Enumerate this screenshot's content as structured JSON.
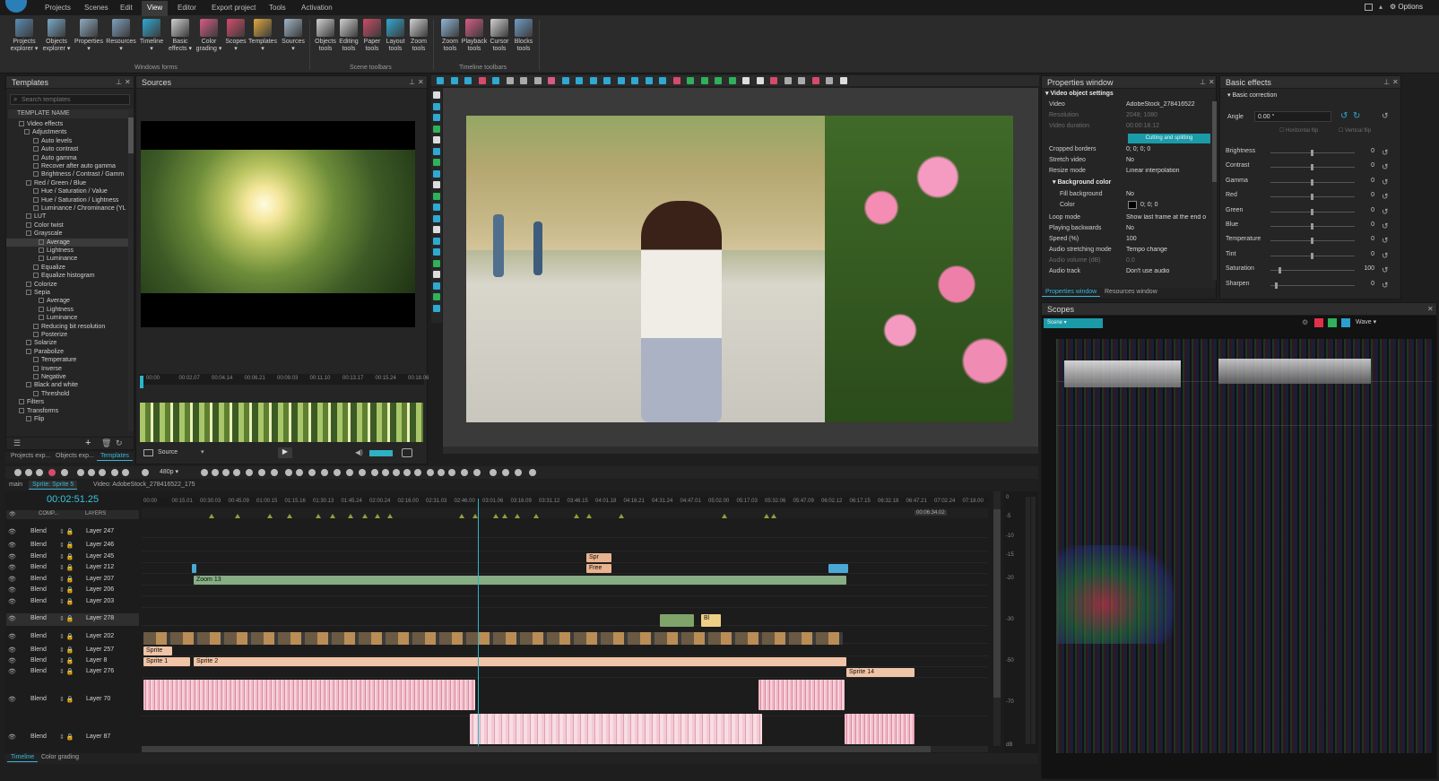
{
  "menu": {
    "items": [
      "Projects",
      "Scenes",
      "Edit",
      "View",
      "Editor",
      "Export project",
      "Tools",
      "Activation"
    ],
    "active": "View",
    "options": "Options"
  },
  "ribbon": {
    "buttons": [
      {
        "label": "Projects\nexplorer ▾",
        "icon": "projects-explorer-icon"
      },
      {
        "label": "Objects\nexplorer ▾",
        "icon": "objects-explorer-icon"
      },
      {
        "label": "Properties\n▾",
        "icon": "properties-icon"
      },
      {
        "label": "Resources\n▾",
        "icon": "resources-icon"
      },
      {
        "label": "Timeline\n▾",
        "icon": "timeline-icon"
      },
      {
        "label": "Basic\neffects ▾",
        "icon": "fx-icon"
      },
      {
        "label": "Color\ngrading ▾",
        "icon": "color-grading-icon"
      },
      {
        "label": "Scopes\n▾",
        "icon": "scopes-icon"
      },
      {
        "label": "Templates\n▾",
        "icon": "templates-icon"
      },
      {
        "label": "Sources\n▾",
        "icon": "sources-icon"
      },
      {
        "label": "Objects\ntools",
        "icon": "gear-icon"
      },
      {
        "label": "Editing\ntools",
        "icon": "pencil-icon"
      },
      {
        "label": "Paper\ntools",
        "icon": "paper-icon"
      },
      {
        "label": "Layout\ntools",
        "icon": "layout-icon"
      },
      {
        "label": "Zoom\ntools",
        "icon": "zoom-icon"
      },
      {
        "label": "Zoom\ntools",
        "icon": "zoom-timeline-icon"
      },
      {
        "label": "Playback\ntools",
        "icon": "playback-icon"
      },
      {
        "label": "Cursor\ntools",
        "icon": "cursor-icon"
      },
      {
        "label": "Blocks\ntools",
        "icon": "blocks-icon"
      }
    ],
    "groups": [
      "Windows forms",
      "Scene toolbars",
      "Timeline toolbars"
    ]
  },
  "templates": {
    "title": "Templates",
    "search_placeholder": "Search templates",
    "column": "TEMPLATE NAME",
    "rows": [
      "Video effects",
      "Adjustments",
      "Auto levels",
      "Auto contrast",
      "Auto gamma",
      "Recover after auto gamma",
      "Brightness / Contrast / Gamm",
      "Red / Green / Blue",
      "Hue / Saturation / Value",
      "Hue / Saturation / Lightness",
      "Luminance / Chrominance (YL",
      "LUT",
      "Color twist",
      "Grayscale",
      "Average",
      "Lightness",
      "Luminance",
      "Equalize",
      "Equalize histogram",
      "Colorize",
      "Sepia",
      "Average",
      "Lightness",
      "Luminance",
      "Reducing bit resolution",
      "Posterize",
      "Solarize",
      "Parabolize",
      "Temperature",
      "Inverse",
      "Negative",
      "Black and white",
      "Threshold",
      "Filters",
      "Transforms",
      "Flip"
    ],
    "tabs": [
      "Projects exp...",
      "Objects exp...",
      "Templates"
    ]
  },
  "sources": {
    "title": "Sources",
    "ruler": [
      "00:00",
      "00:02.07",
      "00:04.14",
      "00:06.21",
      "00:09.03",
      "00:11.10",
      "00:13.17",
      "00:15.24",
      "00:18.06"
    ],
    "source_label": "Source"
  },
  "properties": {
    "title": "Properties window",
    "section": "Video object settings",
    "rows": [
      {
        "k": "Video",
        "v": "AdobeStock_278416522"
      },
      {
        "k": "Resolution",
        "v": "2048; 1080",
        "dim": true
      },
      {
        "k": "Video duration",
        "v": "00:00:18.12",
        "dim": true
      },
      {
        "k": "Cropped borders",
        "v": "0; 0; 0; 0"
      },
      {
        "k": "Stretch video",
        "v": "No"
      },
      {
        "k": "Resize mode",
        "v": "Linear interpolation"
      },
      {
        "k": "Fill background",
        "v": "No"
      },
      {
        "k": "Color",
        "v": "0; 0; 0"
      },
      {
        "k": "Loop mode",
        "v": "Show last frame at the end o"
      },
      {
        "k": "Playing backwards",
        "v": "No"
      },
      {
        "k": "Speed (%)",
        "v": "100"
      },
      {
        "k": "Audio stretching mode",
        "v": "Tempo change"
      },
      {
        "k": "Audio volume (dB)",
        "v": "0.0",
        "dim": true
      },
      {
        "k": "Audio track",
        "v": "Don't use audio"
      }
    ],
    "cutting_btn": "Cutting and splitting",
    "bg_section": "Background color",
    "tabs": [
      "Properties window",
      "Resources window"
    ]
  },
  "basic_effects": {
    "title": "Basic effects",
    "section": "Basic correction",
    "angle_label": "Angle",
    "angle_value": "0.00 °",
    "hflip": "Horizontal flip",
    "vflip": "Vertical flip",
    "sliders": [
      {
        "k": "Brightness",
        "v": "0",
        "pos": 0.5
      },
      {
        "k": "Contrast",
        "v": "0",
        "pos": 0.5
      },
      {
        "k": "Gamma",
        "v": "0",
        "pos": 0.5
      },
      {
        "k": "Red",
        "v": "0",
        "pos": 0.5
      },
      {
        "k": "Green",
        "v": "0",
        "pos": 0.5
      },
      {
        "k": "Blue",
        "v": "0",
        "pos": 0.5
      },
      {
        "k": "Temperature",
        "v": "0",
        "pos": 0.5
      },
      {
        "k": "Tint",
        "v": "0",
        "pos": 0.5
      },
      {
        "k": "Saturation",
        "v": "100",
        "pos": 0.1
      },
      {
        "k": "Sharpen",
        "v": "0",
        "pos": 0.05
      }
    ]
  },
  "scopes": {
    "title": "Scopes",
    "mode": "Scene",
    "wave": "Wave"
  },
  "timeline": {
    "tabs": [
      "main",
      "Sprite: Sprite 5",
      "Video: AdobeStock_278416522_175"
    ],
    "timecode": "00:02:51.25",
    "res": "480p",
    "header": "LAYERS",
    "comp": "COMP...",
    "ruler": [
      "00:00",
      "00:15.01",
      "00:30.03",
      "00:45.09",
      "01:00.15",
      "01:15.16",
      "01:30.13",
      "01:45.24",
      "02:00.24",
      "02:16.00",
      "02:31.03",
      "02:46.00",
      "03:01.06",
      "03:16.09",
      "03:31.12",
      "03:46.15",
      "04:01.18",
      "04:16.21",
      "04:31.24",
      "04:47.01",
      "05:02.00",
      "05:17.03",
      "05:32.06",
      "05:47.09",
      "06:02.12",
      "06:17.15",
      "06:32.18",
      "06:47.21",
      "07:02.24",
      "07:18.00"
    ],
    "end_marker": "00:06:34.02",
    "layers": [
      "Layer 247",
      "Layer 246",
      "Layer 245",
      "Layer 212",
      "Layer 207",
      "Layer 206",
      "Layer 203",
      "Layer 278",
      "Layer 202",
      "Layer 257",
      "Layer 8",
      "Layer 276",
      "Layer 70",
      "Layer 87"
    ],
    "blend": "Blend",
    "clips": {
      "spr": "Spr",
      "free": "Free",
      "zoom": "Zoom 13",
      "sprite": "Sprite",
      "sprite1": "Sprite 1",
      "sprite2": "Sprite 2",
      "sprite14": "Sprite 14",
      "bl": "Bl"
    },
    "bottom_tabs": [
      "Timeline",
      "Color grading"
    ],
    "meter": [
      "0",
      "-5",
      "-10",
      "-15",
      "-20",
      "-30",
      "-50",
      "-70",
      "dB"
    ]
  }
}
